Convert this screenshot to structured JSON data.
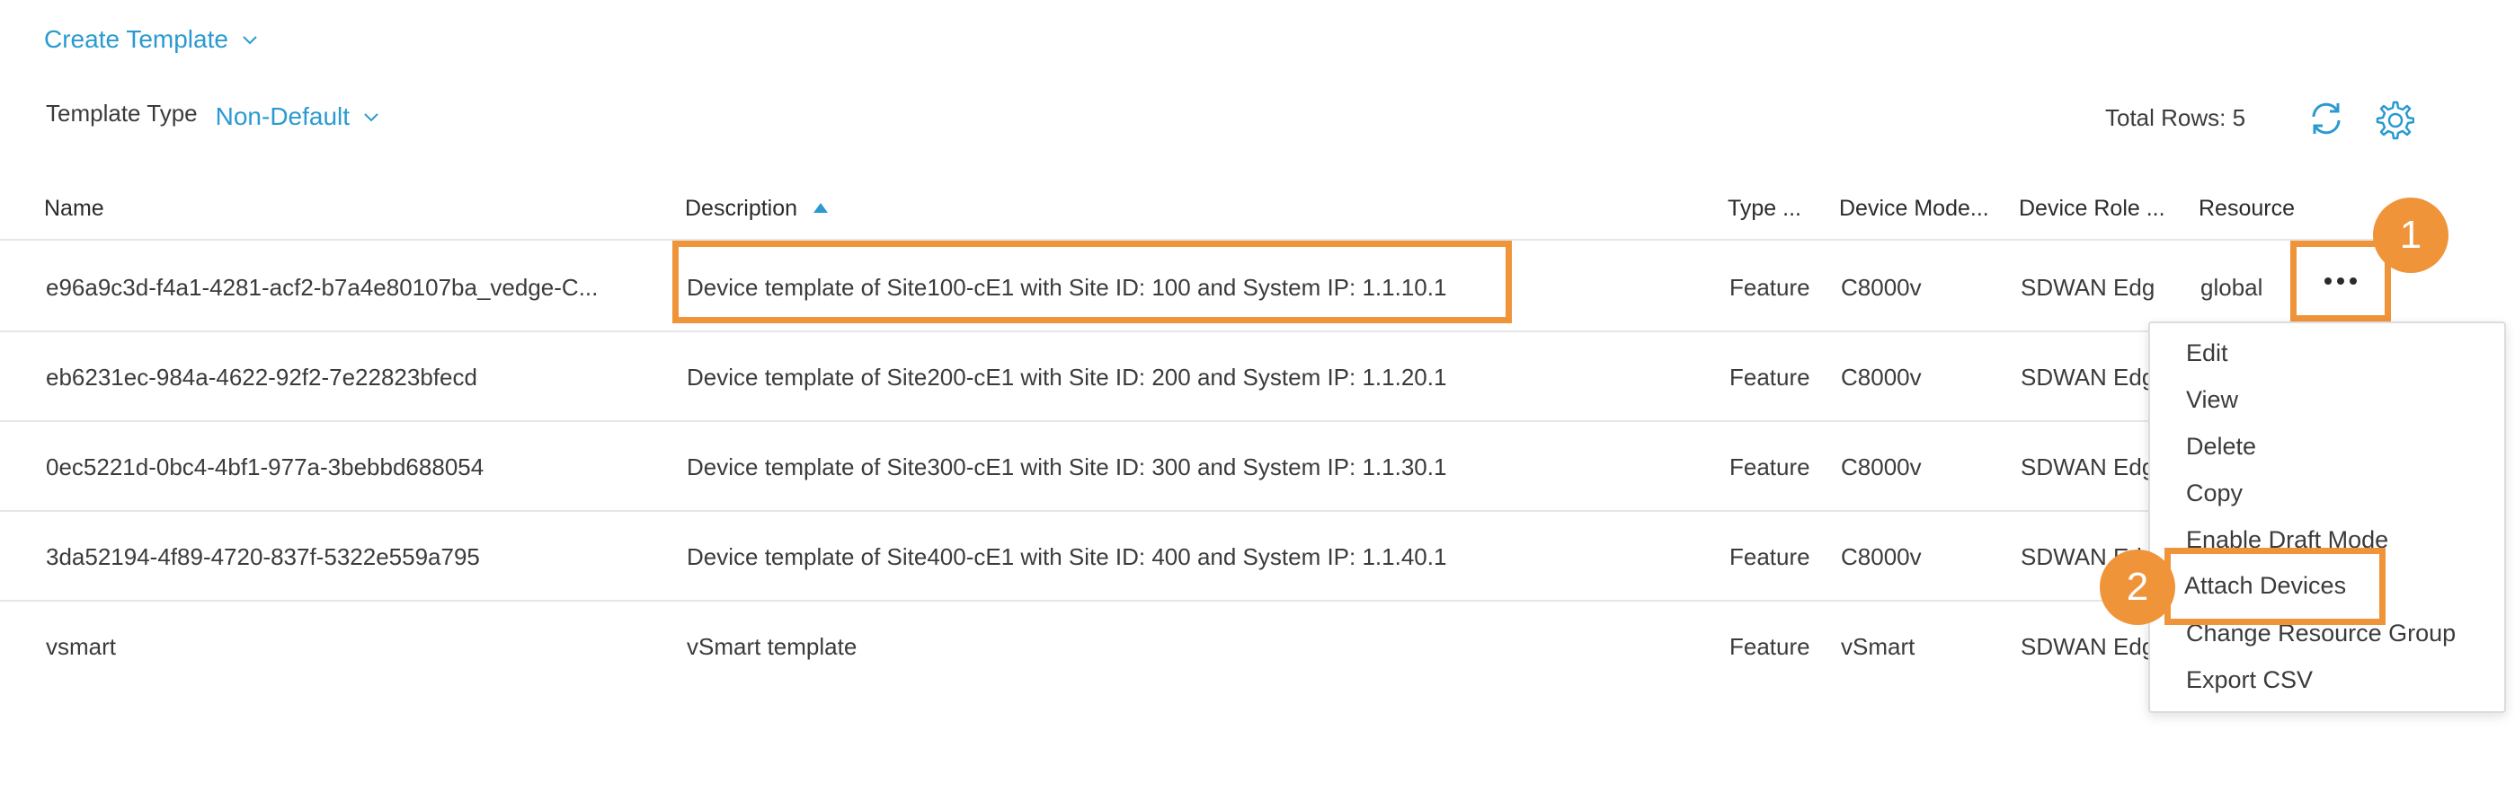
{
  "toolbar": {
    "create_template_label": "Create Template",
    "template_type_label": "Template Type",
    "template_type_value": "Non-Default",
    "total_rows_text": "Total Rows: 5"
  },
  "icons": {
    "refresh": "refresh-icon",
    "settings": "gear-icon",
    "chevron": "chevron-down-icon",
    "more": "more-horizontal-icon",
    "sort": "sort-ascending-icon"
  },
  "colors": {
    "accent": "#2a9ad1",
    "highlight": "#f0943a",
    "text": "#3b3b3b",
    "divider": "#e6e6e6"
  },
  "table": {
    "headers": {
      "name": "Name",
      "description": "Description",
      "type": "Type ...",
      "device_model": "Device Mode...",
      "device_role": "Device Role ...",
      "resource": "Resource"
    },
    "rows": [
      {
        "name": "e96a9c3d-f4a1-4281-acf2-b7a4e80107ba_vedge-C...",
        "description": "Device template of Site100-cE1 with Site ID: 100 and System IP: 1.1.10.1",
        "type": "Feature",
        "device_model": "C8000v",
        "device_role": "SDWAN Edge",
        "resource": "global"
      },
      {
        "name": "eb6231ec-984a-4622-92f2-7e22823bfecd",
        "description": "Device template of Site200-cE1 with Site ID: 200 and System IP: 1.1.20.1",
        "type": "Feature",
        "device_model": "C8000v",
        "device_role": "SDWAN Edge",
        "resource": ""
      },
      {
        "name": "0ec5221d-0bc4-4bf1-977a-3bebbd688054",
        "description": "Device template of Site300-cE1 with Site ID: 300 and System IP: 1.1.30.1",
        "type": "Feature",
        "device_model": "C8000v",
        "device_role": "SDWAN Edge",
        "resource": ""
      },
      {
        "name": "3da52194-4f89-4720-837f-5322e559a795",
        "description": "Device template of Site400-cE1 with Site ID: 400 and System IP: 1.1.40.1",
        "type": "Feature",
        "device_model": "C8000v",
        "device_role": "SDWAN Edge",
        "resource": ""
      },
      {
        "name": "vsmart",
        "description": "vSmart template",
        "type": "Feature",
        "device_model": "vSmart",
        "device_role": "SDWAN Edge",
        "resource": ""
      }
    ]
  },
  "context_menu": {
    "items": [
      "Edit",
      "View",
      "Delete",
      "Copy",
      "Enable Draft Mode",
      "Attach Devices",
      "Change Resource Group",
      "Export CSV"
    ]
  },
  "callouts": {
    "step1": "1",
    "step2": "2"
  }
}
